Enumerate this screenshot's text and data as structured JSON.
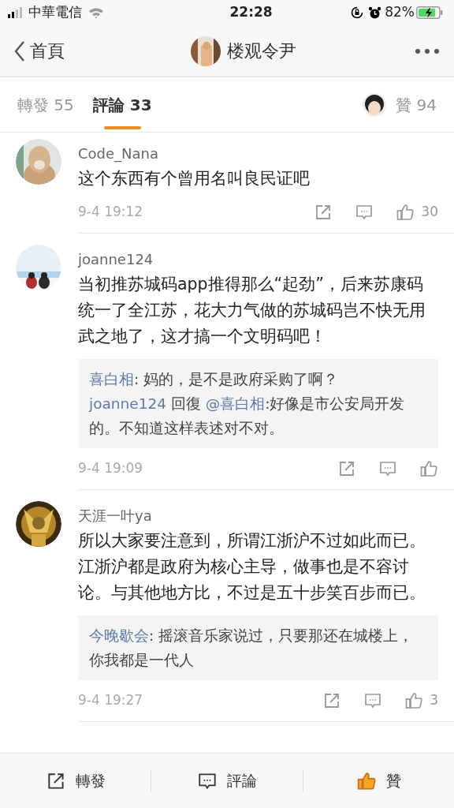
{
  "status_bar": {
    "carrier": "中華電信",
    "time": "22:28",
    "battery": "82%"
  },
  "nav": {
    "back": "首頁",
    "title": "楼观令尹"
  },
  "tabs": [
    {
      "label": "轉發 55",
      "selected": false,
      "kind": "plain"
    },
    {
      "label": "評論 33",
      "selected": true,
      "kind": "plain"
    },
    {
      "label": "贊 94",
      "selected": false,
      "kind": "avatar"
    }
  ],
  "comments": [
    {
      "user": "Code_Nana",
      "text": "这个东西有个曾用名叫良民证吧",
      "time": "9-4 19:12",
      "likes": "30"
    },
    {
      "user": "joanne124",
      "text": "当初推苏城码app推得那么“起劲”，后来苏康码统一了全江苏，花大力气做的苏城码岂不快无用武之地了，这才搞一个文明码吧！",
      "time": "9-4 19:09",
      "replies": [
        {
          "user": "喜白相",
          "text": ": 妈的，是不是政府采购了啊？"
        },
        {
          "user": "joanne124",
          "verb": "回復",
          "target": "@喜白相",
          "text": ":好像是市公安局开发的。不知道这样表述对不对。"
        }
      ]
    },
    {
      "user": "天涯一叶ya",
      "text": "所以大家要注意到，所谓江浙沪不过如此而已。江浙沪都是政府为核心主导，做事也是不容讨论。与其他地方比，不过是五十步笑百步而已。",
      "time": "9-4 19:27",
      "likes": "3",
      "replies": [
        {
          "user": "今晚歇会",
          "text": ": 摇滚音乐家说过，只要那还在城楼上，你我都是一代人"
        }
      ]
    }
  ],
  "toolbar": [
    {
      "label": "轉發",
      "kind": "repost"
    },
    {
      "label": "評論",
      "kind": "comment"
    },
    {
      "label": "贊",
      "kind": "like",
      "liked": true
    }
  ]
}
